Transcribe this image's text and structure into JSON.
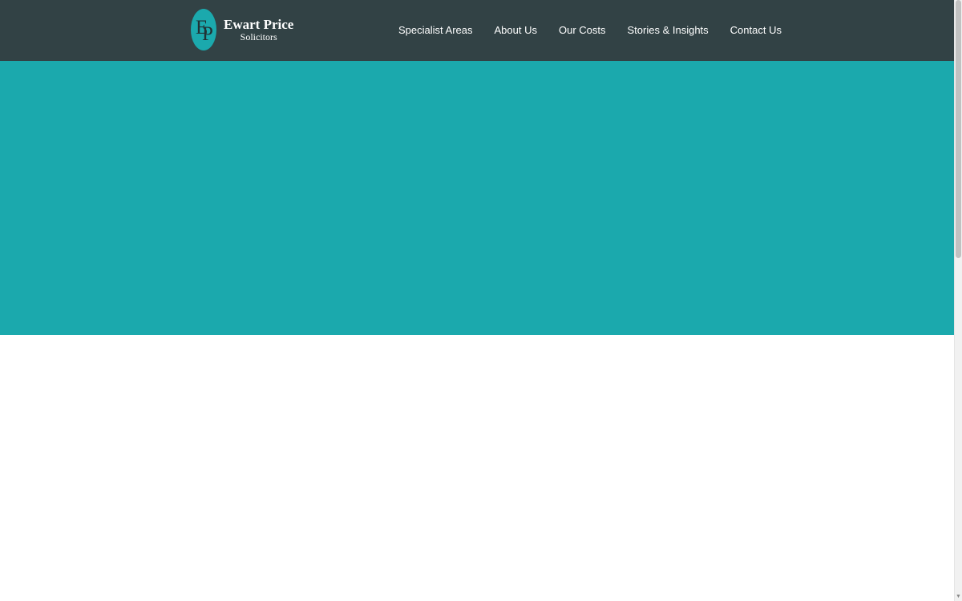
{
  "colors": {
    "header_background": "#324245",
    "accent_teal": "#1ba9ad",
    "page_background": "#ffffff",
    "nav_text": "#ffffff"
  },
  "logo": {
    "monogram_first": "E",
    "monogram_second": "P",
    "name": "Ewart Price",
    "subtitle": "Solicitors"
  },
  "nav": {
    "items": [
      {
        "label": "Specialist Areas"
      },
      {
        "label": "About Us"
      },
      {
        "label": "Our Costs"
      },
      {
        "label": "Stories & Insights"
      },
      {
        "label": "Contact Us"
      }
    ]
  },
  "icons": {
    "scroll_down": "chevron-down-icon"
  }
}
